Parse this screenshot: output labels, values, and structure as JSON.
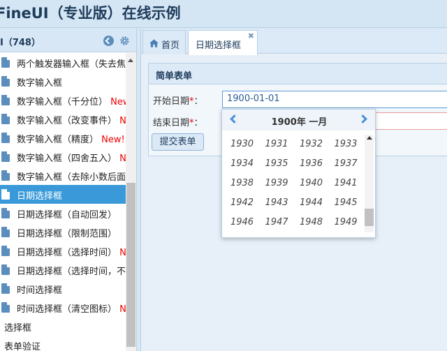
{
  "app": {
    "title": "FineUI（专业版）在线示例"
  },
  "sidebar": {
    "title": "I（748）",
    "items": [
      {
        "label": "两个触发器输入框（失去焦",
        "new": ""
      },
      {
        "label": "数字输入框",
        "new": ""
      },
      {
        "label": "数字输入框（千分位） ",
        "new": "New"
      },
      {
        "label": "数字输入框（改变事件） ",
        "new": "N"
      },
      {
        "label": "数字输入框（精度） ",
        "new": "New!"
      },
      {
        "label": "数字输入框（四舍五入） ",
        "new": "N"
      },
      {
        "label": "数字输入框（去除小数后面",
        "new": ""
      },
      {
        "label": "日期选择框",
        "new": ""
      },
      {
        "label": "日期选择框（自动回发）",
        "new": ""
      },
      {
        "label": "日期选择框（限制范围）",
        "new": ""
      },
      {
        "label": "日期选择框（选择时间） ",
        "new": "N"
      },
      {
        "label": "日期选择框（选择时间，不",
        "new": ""
      },
      {
        "label": "时间选择框",
        "new": ""
      },
      {
        "label": "时间选择框（清空图标） ",
        "new": "N"
      }
    ],
    "plain_items": [
      "选择框",
      "表单验证"
    ]
  },
  "tabs": [
    {
      "label": "首页"
    },
    {
      "label": "日期选择框"
    }
  ],
  "form": {
    "title": "简单表单",
    "start_label": "开始日期",
    "end_label": "结束日期",
    "required_mark": "*",
    "colon": "：",
    "start_value": "1900-01-01",
    "end_value": "",
    "submit_label": "提交表单"
  },
  "picker": {
    "title": "1900年 一月",
    "years": [
      "1930",
      "1931",
      "1932",
      "1933",
      "1934",
      "1935",
      "1936",
      "1937",
      "1938",
      "1939",
      "1940",
      "1941",
      "1942",
      "1943",
      "1944",
      "1945",
      "1946",
      "1947",
      "1948",
      "1949"
    ]
  },
  "colors": {
    "accent": "#3a9ad9",
    "new_badge": "#ee0000",
    "required": "#ee0000"
  }
}
